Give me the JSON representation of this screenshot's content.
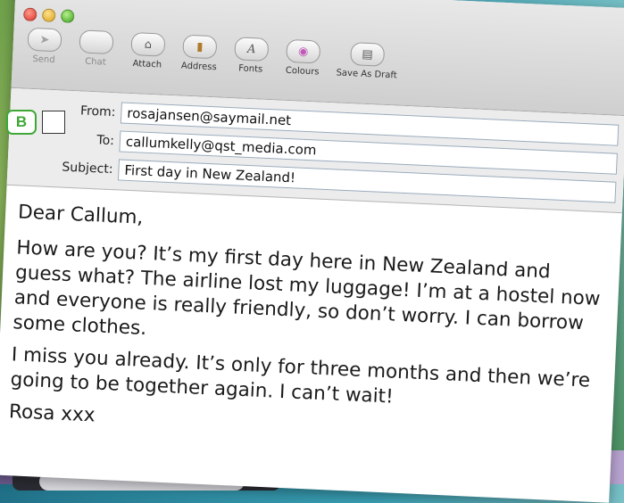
{
  "toolbar": {
    "items": [
      {
        "label": "Send",
        "icon": "send-icon",
        "glyph": "➤",
        "enabled": false
      },
      {
        "label": "Chat",
        "icon": "chat-icon",
        "glyph": "",
        "enabled": false
      },
      {
        "label": "Attach",
        "icon": "paperclip-icon",
        "glyph": "⌂",
        "enabled": true
      },
      {
        "label": "Address",
        "icon": "address-book-icon",
        "glyph": "▮",
        "enabled": true
      },
      {
        "label": "Fonts",
        "icon": "fonts-icon",
        "glyph": "A",
        "enabled": true
      },
      {
        "label": "Colours",
        "icon": "colour-wheel-icon",
        "glyph": "◉",
        "enabled": true
      },
      {
        "label": "Save As Draft",
        "icon": "draft-icon",
        "glyph": "▤",
        "enabled": true
      }
    ]
  },
  "headers": {
    "from_label": "From:",
    "from_value": "rosajansen@saymail.net",
    "to_label": "To:",
    "to_value": "callumkelly@qst_media.com",
    "subject_label": "Subject:",
    "subject_value": "First day in New Zealand!"
  },
  "exercise": {
    "badge_letter": "B"
  },
  "message": {
    "greeting": "Dear Callum,",
    "paragraph1": "How are you? It’s my first day here in New Zealand and guess what? The airline lost my luggage! I’m at a hostel now and everyone is really friendly, so don’t worry. I can borrow some clothes.",
    "paragraph2": "I miss you already. It’s only for three months and then we’re going to be together again. I can’t wait!",
    "signature": "Rosa xxx"
  }
}
